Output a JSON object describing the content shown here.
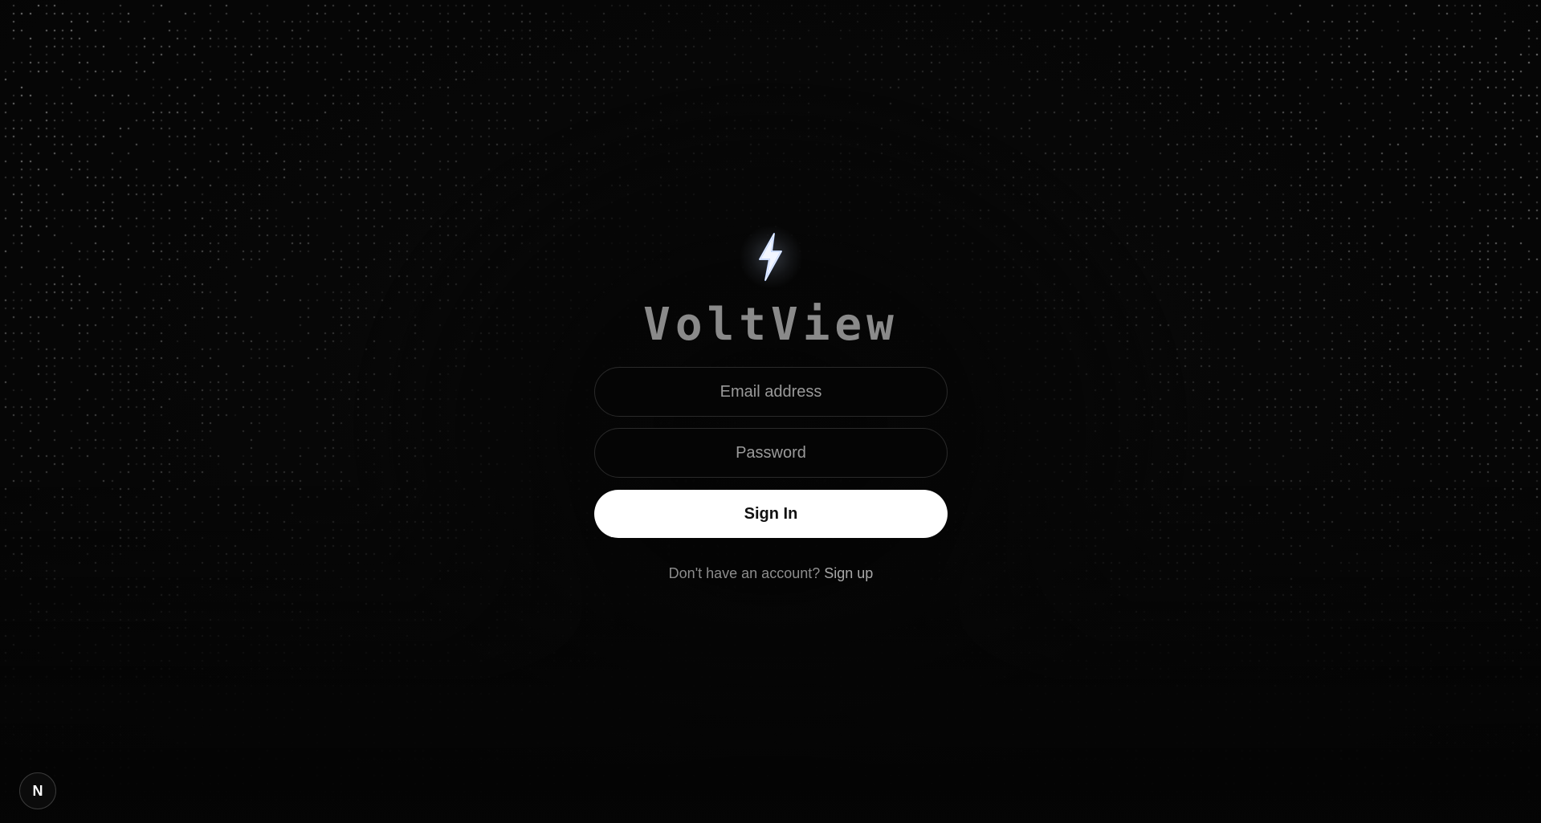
{
  "brand": {
    "name": "VoltView",
    "logo_icon": "lightning-bolt-icon"
  },
  "form": {
    "email_placeholder": "Email address",
    "password_placeholder": "Password",
    "signin_label": "Sign In"
  },
  "footer": {
    "prompt_text": "Don't have an account?",
    "signup_link": "Sign up"
  },
  "dev_badge": {
    "label": "N",
    "icon": "nextjs-logo-icon"
  },
  "colors": {
    "background": "#050505",
    "dot": "#9a9a9a",
    "button_bg": "#ffffff",
    "button_text": "#111111",
    "brand_text": "#8a8a8a",
    "bolt_accent": "#a9c4ff"
  }
}
